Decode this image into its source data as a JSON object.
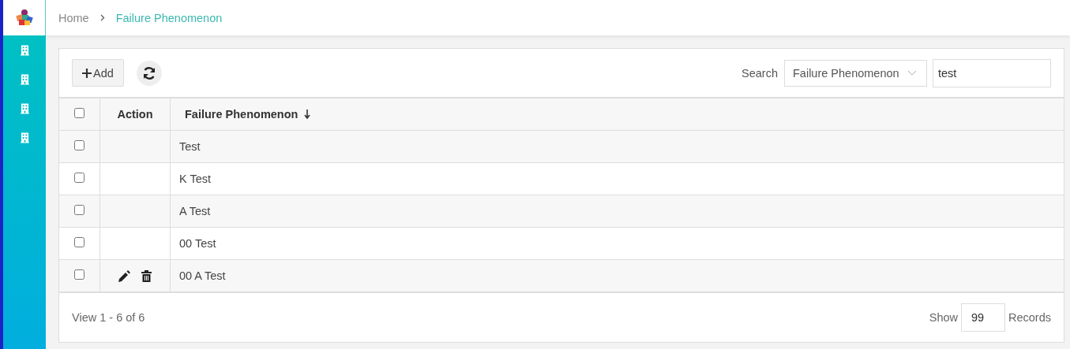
{
  "sidebar": {
    "items": [
      {
        "selected": false
      },
      {
        "selected": false
      },
      {
        "selected": false
      },
      {
        "selected": false
      }
    ]
  },
  "breadcrumb": [
    "Home",
    "Failure Phenomenon"
  ],
  "toolbar": {
    "add_button": "Add",
    "search_label": "Search",
    "search_field": "Failure Phenomenon",
    "search_value": "test"
  },
  "table": {
    "header_checked": false,
    "columns": [
      "Action",
      "Failure Phenomenon"
    ],
    "rows": [
      {
        "checked": false,
        "actions": false,
        "name": "Test"
      },
      {
        "checked": false,
        "actions": false,
        "name": "K Test"
      },
      {
        "checked": false,
        "actions": false,
        "name": "A Test"
      },
      {
        "checked": false,
        "actions": false,
        "name": "00 Test"
      },
      {
        "checked": false,
        "actions": true,
        "name": "00 A Test"
      }
    ]
  },
  "footer": {
    "view": "View 1 - 6 of 6",
    "show_label": "Show",
    "page_size": "99",
    "records_label": "Records"
  }
}
